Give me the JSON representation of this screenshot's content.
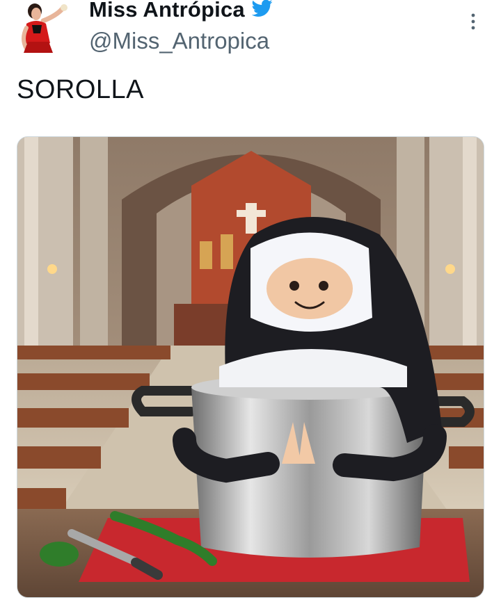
{
  "tweet": {
    "display_name": "Miss Antrópica",
    "handle": "@Miss_Antropica",
    "text": "SOROLLA"
  },
  "icons": {
    "verified": "twitter-bird-icon",
    "more": "more-vertical-icon"
  },
  "colors": {
    "handle": "#536471",
    "bird": "#1d9bf0"
  }
}
